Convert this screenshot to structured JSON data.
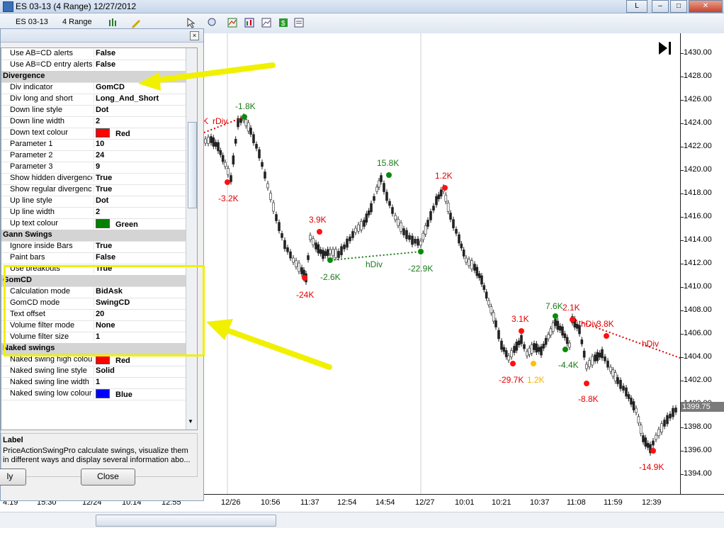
{
  "window": {
    "title": "ES 03-13 (4 Range)  12/27/2012",
    "buttons": [
      "L",
      "–",
      "□",
      "✕"
    ]
  },
  "toolbar": {
    "instrument": "ES 03-13",
    "period": "4 Range"
  },
  "panel": {
    "rows": [
      {
        "type": "prop",
        "key": "Use AB=CD alerts",
        "value": "False"
      },
      {
        "type": "prop",
        "key": "Use AB=CD entry alerts",
        "value": "False"
      },
      {
        "type": "cat",
        "key": "Divergence"
      },
      {
        "type": "prop",
        "key": "Div indicator",
        "value": "GomCD"
      },
      {
        "type": "prop",
        "key": "Div long and short",
        "value": "Long_And_Short"
      },
      {
        "type": "prop",
        "key": "Down line style",
        "value": "Dot"
      },
      {
        "type": "prop",
        "key": "Down line width",
        "value": "2"
      },
      {
        "type": "prop",
        "key": "Down text colour",
        "value": "Red",
        "swatch": "#ff0000"
      },
      {
        "type": "prop",
        "key": "Parameter 1",
        "value": "10"
      },
      {
        "type": "prop",
        "key": "Parameter 2",
        "value": "24"
      },
      {
        "type": "prop",
        "key": "Parameter 3",
        "value": "9"
      },
      {
        "type": "prop",
        "key": "Show hidden divergences",
        "value": "True"
      },
      {
        "type": "prop",
        "key": "Show regular divergences",
        "value": "True"
      },
      {
        "type": "prop",
        "key": "Up line style",
        "value": "Dot"
      },
      {
        "type": "prop",
        "key": "Up line width",
        "value": "2"
      },
      {
        "type": "prop",
        "key": "Up text colour",
        "value": "Green",
        "swatch": "#008000"
      },
      {
        "type": "cat",
        "key": "Gann Swings"
      },
      {
        "type": "prop",
        "key": "Ignore inside Bars",
        "value": "True"
      },
      {
        "type": "prop",
        "key": "Paint bars",
        "value": "False"
      },
      {
        "type": "prop",
        "key": "Use breakouts",
        "value": "True"
      },
      {
        "type": "cat",
        "key": "GomCD"
      },
      {
        "type": "prop",
        "key": "Calculation mode",
        "value": "BidAsk"
      },
      {
        "type": "prop",
        "key": "GomCD mode",
        "value": "SwingCD"
      },
      {
        "type": "prop",
        "key": "Text offset",
        "value": "20"
      },
      {
        "type": "prop",
        "key": "Volume filter mode",
        "value": "None"
      },
      {
        "type": "prop",
        "key": "Volume filter size",
        "value": "1"
      },
      {
        "type": "cat",
        "key": "Naked swings"
      },
      {
        "type": "prop",
        "key": "Naked swing high colour",
        "value": "Red",
        "swatch": "#ff0000"
      },
      {
        "type": "prop",
        "key": "Naked swing line style",
        "value": "Solid"
      },
      {
        "type": "prop",
        "key": "Naked swing line width",
        "value": "1"
      },
      {
        "type": "prop",
        "key": "Naked swing low colour",
        "value": "Blue",
        "swatch": "#0000ff"
      }
    ],
    "desc_title": "Label",
    "desc_text": "PriceActionSwingPro calculate swings, visualize them in different ways and display several information abo...",
    "apply_label": "ly",
    "close_label": "Close"
  },
  "price_axis": {
    "labels": [
      "1430.00",
      "1428.00",
      "1426.00",
      "1424.00",
      "1422.00",
      "1420.00",
      "1418.00",
      "1416.00",
      "1414.00",
      "1412.00",
      "1410.00",
      "1408.00",
      "1406.00",
      "1404.00",
      "1402.00",
      "1400.00",
      "1398.00",
      "1396.00",
      "1394.00"
    ],
    "current": "1399.75"
  },
  "time_axis": {
    "labels": [
      "4:19",
      "15:30",
      "12/24",
      "10:14",
      "12:55",
      "12/26",
      "10:56",
      "11:37",
      "12:54",
      "14:54",
      "12/27",
      "10:01",
      "10:21",
      "10:37",
      "11:08",
      "11:59",
      "12:39"
    ]
  },
  "chart_annotations": {
    "swing_labels": [
      {
        "text": "-1.8K",
        "color": "#1a7a1a"
      },
      {
        "text": "-3.2K",
        "color": "#e00000"
      },
      {
        "text": "3.9K",
        "color": "#e00000"
      },
      {
        "text": "-24K",
        "color": "#e00000"
      },
      {
        "text": "-2.6K",
        "color": "#1a7a1a"
      },
      {
        "text": "15.8K",
        "color": "#1a7a1a"
      },
      {
        "text": "-22.9K",
        "color": "#1a7a1a"
      },
      {
        "text": "1.2K",
        "color": "#e00000"
      },
      {
        "text": "3.1K",
        "color": "#e00000"
      },
      {
        "text": "-29.7K",
        "color": "#e00000"
      },
      {
        "text": "1.2K",
        "color": "#f0b400"
      },
      {
        "text": "7.6K",
        "color": "#1a7a1a"
      },
      {
        "text": "2.1K",
        "color": "#e00000"
      },
      {
        "text": "-4.4K",
        "color": "#1a7a1a"
      },
      {
        "text": "3.8K",
        "color": "#e00000"
      },
      {
        "text": "-8.8K",
        "color": "#e00000"
      },
      {
        "text": "-14.9K",
        "color": "#e00000"
      }
    ],
    "div_labels": [
      {
        "text": "rDiv",
        "color": "#e00000"
      },
      {
        "text": "hDiv",
        "color": "#1a7a1a"
      },
      {
        "text": "hDiv",
        "color": "#e00000"
      },
      {
        "text": "hDiv",
        "color": "#e00000"
      }
    ],
    "k_marker": "K"
  }
}
